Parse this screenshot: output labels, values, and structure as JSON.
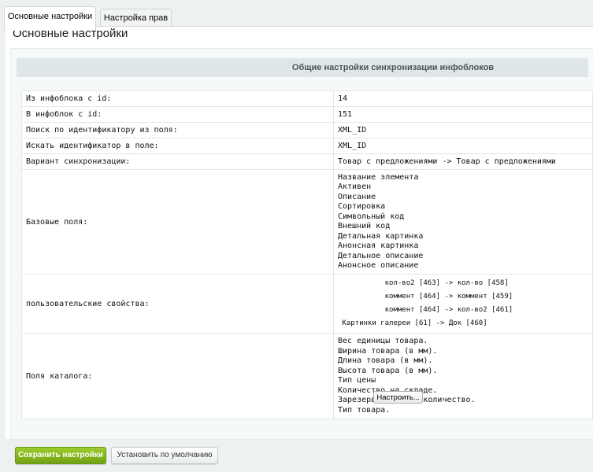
{
  "tabs": [
    {
      "label": "Основные настройки",
      "active": true
    },
    {
      "label": "Настройка прав",
      "active": false
    }
  ],
  "page_title": "Основные настройки",
  "section_header": "Общие настройки синхронизации инфоблоков",
  "rows": {
    "from_iblock": {
      "label": "Из инфоблока с id:",
      "value": "14"
    },
    "to_iblock": {
      "label": "В инфоблок с id:",
      "value": "151"
    },
    "search_field": {
      "label": "Поиск по идентификатору из поля:",
      "value": "XML_ID"
    },
    "target_field": {
      "label": "Искать идентификатор в поле:",
      "value": "XML_ID"
    },
    "sync_variant": {
      "label": "Вариант синхронизации:",
      "value": "Товар с предложениями -> Товар с предложениями"
    },
    "base_fields": {
      "label": "Базовые поля:",
      "values": [
        "Название элемента",
        "Активен",
        "Описание",
        "Сортировка",
        "Символьный код",
        "Внешний код",
        "Детальная картинка",
        "Анонсная картинка",
        "Детальное описание",
        "Анонсное описание"
      ]
    },
    "user_props": {
      "label": "пользовательские свойства:",
      "values": [
        "           кол-во2 [463] -> кол-во [458]",
        "           коммент [464] -> коммент [459]",
        "           коммент [464] -> кол-во2 [461]",
        " Картинки галереи [61] -> Док [460]"
      ]
    },
    "catalog_fields": {
      "label": "Поля каталога:",
      "values": [
        "Вес единицы товара.",
        "Ширина товара (в мм).",
        "Длина товара (в мм).",
        "Высота товара (в мм).",
        "Тип цены",
        "Количество на складе.",
        "Зарезервированное количество.",
        "Тип товара."
      ]
    }
  },
  "buttons": {
    "configure": "Настроить...",
    "save": "Сохранить настройки",
    "default": "Установить по умолчанию"
  },
  "colors": {
    "save_button": "#7fb21c",
    "header_bg": "#dfe6e7"
  }
}
